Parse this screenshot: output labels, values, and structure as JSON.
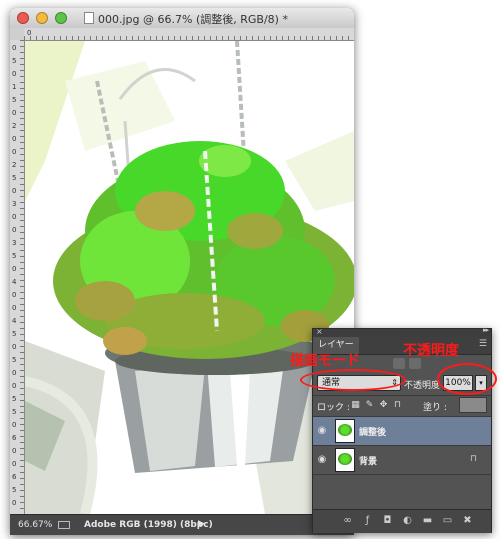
{
  "window": {
    "title": "000.jpg @ 66.7% (調整後, RGB/8) *"
  },
  "rulers": {
    "top_label": "0",
    "left_labels": [
      "0",
      "5",
      "0",
      "1",
      "5",
      "0",
      "2",
      "0",
      "0",
      "2",
      "5",
      "0",
      "3",
      "0",
      "0",
      "3",
      "5",
      "0",
      "4",
      "0",
      "0",
      "4",
      "5",
      "0",
      "5",
      "0",
      "0",
      "5",
      "5",
      "0",
      "6",
      "0",
      "0",
      "6",
      "5",
      "0"
    ]
  },
  "status": {
    "zoom": "66.67%",
    "profile": "Adobe RGB (1998) (8bpc)",
    "arrow": "▶"
  },
  "layers_panel": {
    "tab_label": "レイヤー",
    "menu_icon": "panel-menu-icon",
    "blend_mode": "通常",
    "opacity_label": "不透明度 :",
    "opacity_value": "100%",
    "lock_label": "ロック :",
    "fill_label": "塗り :",
    "fill_value": "",
    "layers": [
      {
        "name": "調整後",
        "selected": true,
        "locked": false
      },
      {
        "name": "背景",
        "selected": false,
        "locked": true
      }
    ]
  },
  "annotations": {
    "blend_mode": "描画モード",
    "opacity": "不透明度"
  },
  "colors": {
    "annotation_red": "#ff1a1a",
    "selected_layer": "#6d7f99",
    "panel_bg": "#535353"
  }
}
